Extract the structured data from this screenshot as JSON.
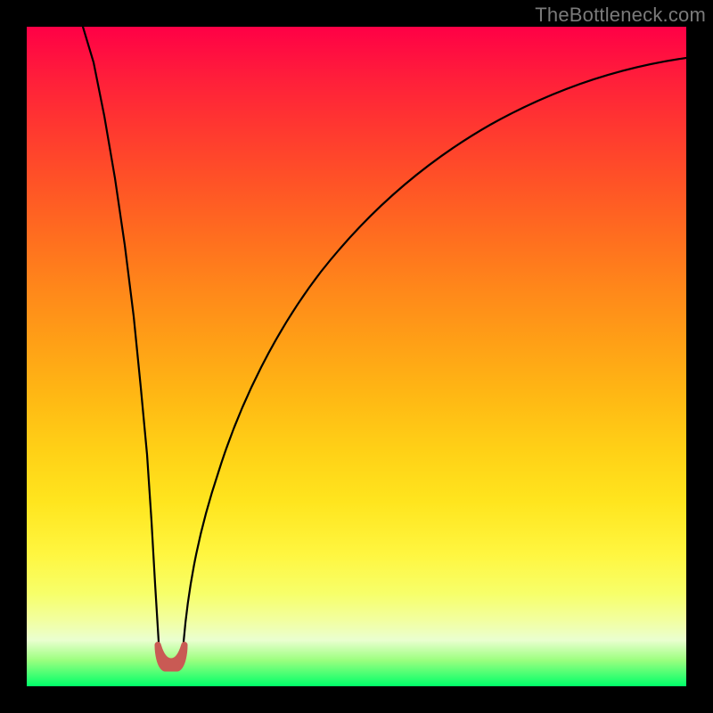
{
  "watermark": {
    "text": "TheBottleneck.com"
  },
  "chart_data": {
    "type": "line",
    "title": "",
    "xlabel": "",
    "ylabel": "",
    "x_range": [
      0,
      1
    ],
    "y_range": [
      0,
      1
    ],
    "grid": false,
    "legend": false,
    "background_gradient": {
      "orientation": "vertical",
      "stops": [
        {
          "pos": 0.0,
          "color": "#ff0046"
        },
        {
          "pos": 0.5,
          "color": "#ffa016"
        },
        {
          "pos": 0.8,
          "color": "#fff640"
        },
        {
          "pos": 0.93,
          "color": "#eaffd0"
        },
        {
          "pos": 1.0,
          "color": "#00ff69"
        }
      ]
    },
    "series": [
      {
        "name": "left-branch",
        "color": "#000000",
        "x": [
          0.0,
          0.02,
          0.04,
          0.06,
          0.08,
          0.1,
          0.12,
          0.14,
          0.16,
          0.18,
          0.195
        ],
        "y": [
          1.0,
          0.905,
          0.81,
          0.715,
          0.62,
          0.525,
          0.43,
          0.335,
          0.24,
          0.145,
          0.07
        ]
      },
      {
        "name": "right-branch",
        "color": "#000000",
        "x": [
          0.235,
          0.26,
          0.29,
          0.33,
          0.38,
          0.44,
          0.51,
          0.59,
          0.68,
          0.78,
          0.89,
          1.0
        ],
        "y": [
          0.07,
          0.19,
          0.305,
          0.42,
          0.52,
          0.61,
          0.69,
          0.76,
          0.82,
          0.87,
          0.91,
          0.945
        ]
      },
      {
        "name": "valley-bump",
        "color": "#c95a54",
        "x": [
          0.195,
          0.205,
          0.215,
          0.225,
          0.235
        ],
        "y": [
          0.06,
          0.025,
          0.025,
          0.025,
          0.06
        ]
      }
    ]
  }
}
